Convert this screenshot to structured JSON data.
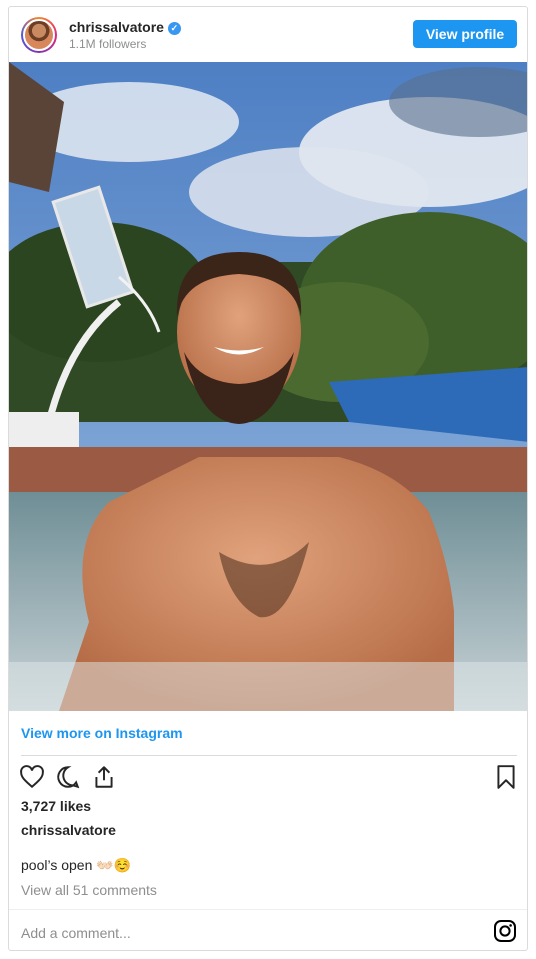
{
  "header": {
    "username": "chrissalvatore",
    "followers": "1.1M followers",
    "view_profile_label": "View profile",
    "verified_icon": "verified-badge-icon"
  },
  "post": {
    "view_more_label": "View more on Instagram",
    "likes": "3,727 likes",
    "caption_user": "chrissalvatore",
    "caption_text": "pool’s open 👐🏻☺️",
    "comments_link": "View all 51 comments",
    "add_comment_placeholder": "Add a comment..."
  },
  "icons": [
    "heart-icon",
    "comment-icon",
    "share-icon",
    "bookmark-icon",
    "instagram-icon"
  ],
  "colors": {
    "accent": "#1c96f0",
    "text": "#262626",
    "muted": "#8e8e8e",
    "border": "#dbdbdb"
  }
}
